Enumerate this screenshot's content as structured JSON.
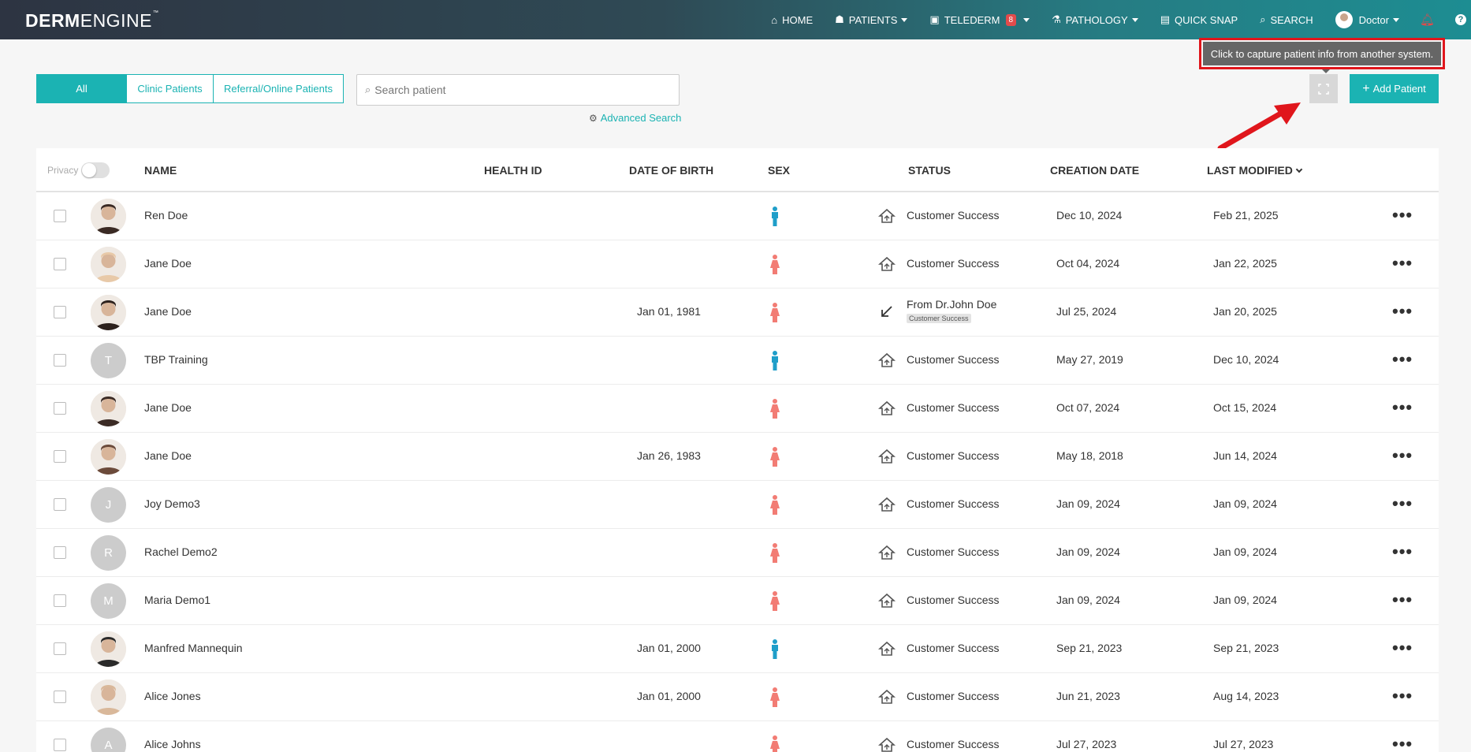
{
  "brand": {
    "bold": "DERM",
    "light": "ENGINE",
    "tm": "™"
  },
  "nav": {
    "home": "HOME",
    "patients": "PATIENTS",
    "telederm": "TELEDERM",
    "telederm_count": "8",
    "pathology": "PATHOLOGY",
    "quick_snap": "QUICK SNAP",
    "search": "SEARCH",
    "user": "Doctor",
    "help": "?"
  },
  "tooltip": "Click to capture patient info from another system.",
  "filters": {
    "all": "All",
    "clinic": "Clinic Patients",
    "referral": "Referral/Online Patients"
  },
  "search": {
    "placeholder": "Search patient",
    "advanced": "Advanced Search"
  },
  "add_patient": "Add Patient",
  "table": {
    "privacy": "Privacy",
    "headers": {
      "name": "NAME",
      "health_id": "HEALTH ID",
      "dob": "DATE OF BIRTH",
      "sex": "SEX",
      "status": "STATUS",
      "created": "CREATION DATE",
      "modified": "LAST MODIFIED"
    },
    "rows": [
      {
        "name": "Ren Doe",
        "initial": "",
        "dob": "",
        "sex": "male",
        "status_type": "home",
        "status": "Customer Success",
        "status_sub": "",
        "created": "Dec 10, 2024",
        "modified": "Feb 21, 2025"
      },
      {
        "name": "Jane Doe",
        "initial": "",
        "dob": "",
        "sex": "female",
        "status_type": "home",
        "status": "Customer Success",
        "status_sub": "",
        "created": "Oct 04, 2024",
        "modified": "Jan 22, 2025"
      },
      {
        "name": "Jane Doe",
        "initial": "",
        "dob": "Jan 01, 1981",
        "sex": "female",
        "status_type": "referral",
        "status": "From Dr.John Doe",
        "status_sub": "Customer Success",
        "created": "Jul 25, 2024",
        "modified": "Jan 20, 2025"
      },
      {
        "name": "TBP Training",
        "initial": "T",
        "dob": "",
        "sex": "male",
        "status_type": "home",
        "status": "Customer Success",
        "status_sub": "",
        "created": "May 27, 2019",
        "modified": "Dec 10, 2024"
      },
      {
        "name": "Jane Doe",
        "initial": "",
        "dob": "",
        "sex": "female",
        "status_type": "home",
        "status": "Customer Success",
        "status_sub": "",
        "created": "Oct 07, 2024",
        "modified": "Oct 15, 2024"
      },
      {
        "name": "Jane Doe",
        "initial": "",
        "dob": "Jan 26, 1983",
        "sex": "female",
        "status_type": "home",
        "status": "Customer Success",
        "status_sub": "",
        "created": "May 18, 2018",
        "modified": "Jun 14, 2024"
      },
      {
        "name": "Joy Demo3",
        "initial": "J",
        "dob": "",
        "sex": "female",
        "status_type": "home",
        "status": "Customer Success",
        "status_sub": "",
        "created": "Jan 09, 2024",
        "modified": "Jan 09, 2024"
      },
      {
        "name": "Rachel Demo2",
        "initial": "R",
        "dob": "",
        "sex": "female",
        "status_type": "home",
        "status": "Customer Success",
        "status_sub": "",
        "created": "Jan 09, 2024",
        "modified": "Jan 09, 2024"
      },
      {
        "name": "Maria Demo1",
        "initial": "M",
        "dob": "",
        "sex": "female",
        "status_type": "home",
        "status": "Customer Success",
        "status_sub": "",
        "created": "Jan 09, 2024",
        "modified": "Jan 09, 2024"
      },
      {
        "name": "Manfred Mannequin",
        "initial": "",
        "dob": "Jan 01, 2000",
        "sex": "male",
        "status_type": "home",
        "status": "Customer Success",
        "status_sub": "",
        "created": "Sep 21, 2023",
        "modified": "Sep 21, 2023"
      },
      {
        "name": "Alice Jones",
        "initial": "",
        "dob": "Jan 01, 2000",
        "sex": "female",
        "status_type": "home",
        "status": "Customer Success",
        "status_sub": "",
        "created": "Jun 21, 2023",
        "modified": "Aug 14, 2023"
      },
      {
        "name": "Alice Johns",
        "initial": "A",
        "dob": "",
        "sex": "female",
        "status_type": "home",
        "status": "Customer Success",
        "status_sub": "",
        "created": "Jul 27, 2023",
        "modified": "Jul 27, 2023"
      }
    ]
  },
  "colors": {
    "accent": "#1bb3b3",
    "male": "#1f9ec9",
    "female": "#f27c74",
    "alert": "#e0161c"
  }
}
